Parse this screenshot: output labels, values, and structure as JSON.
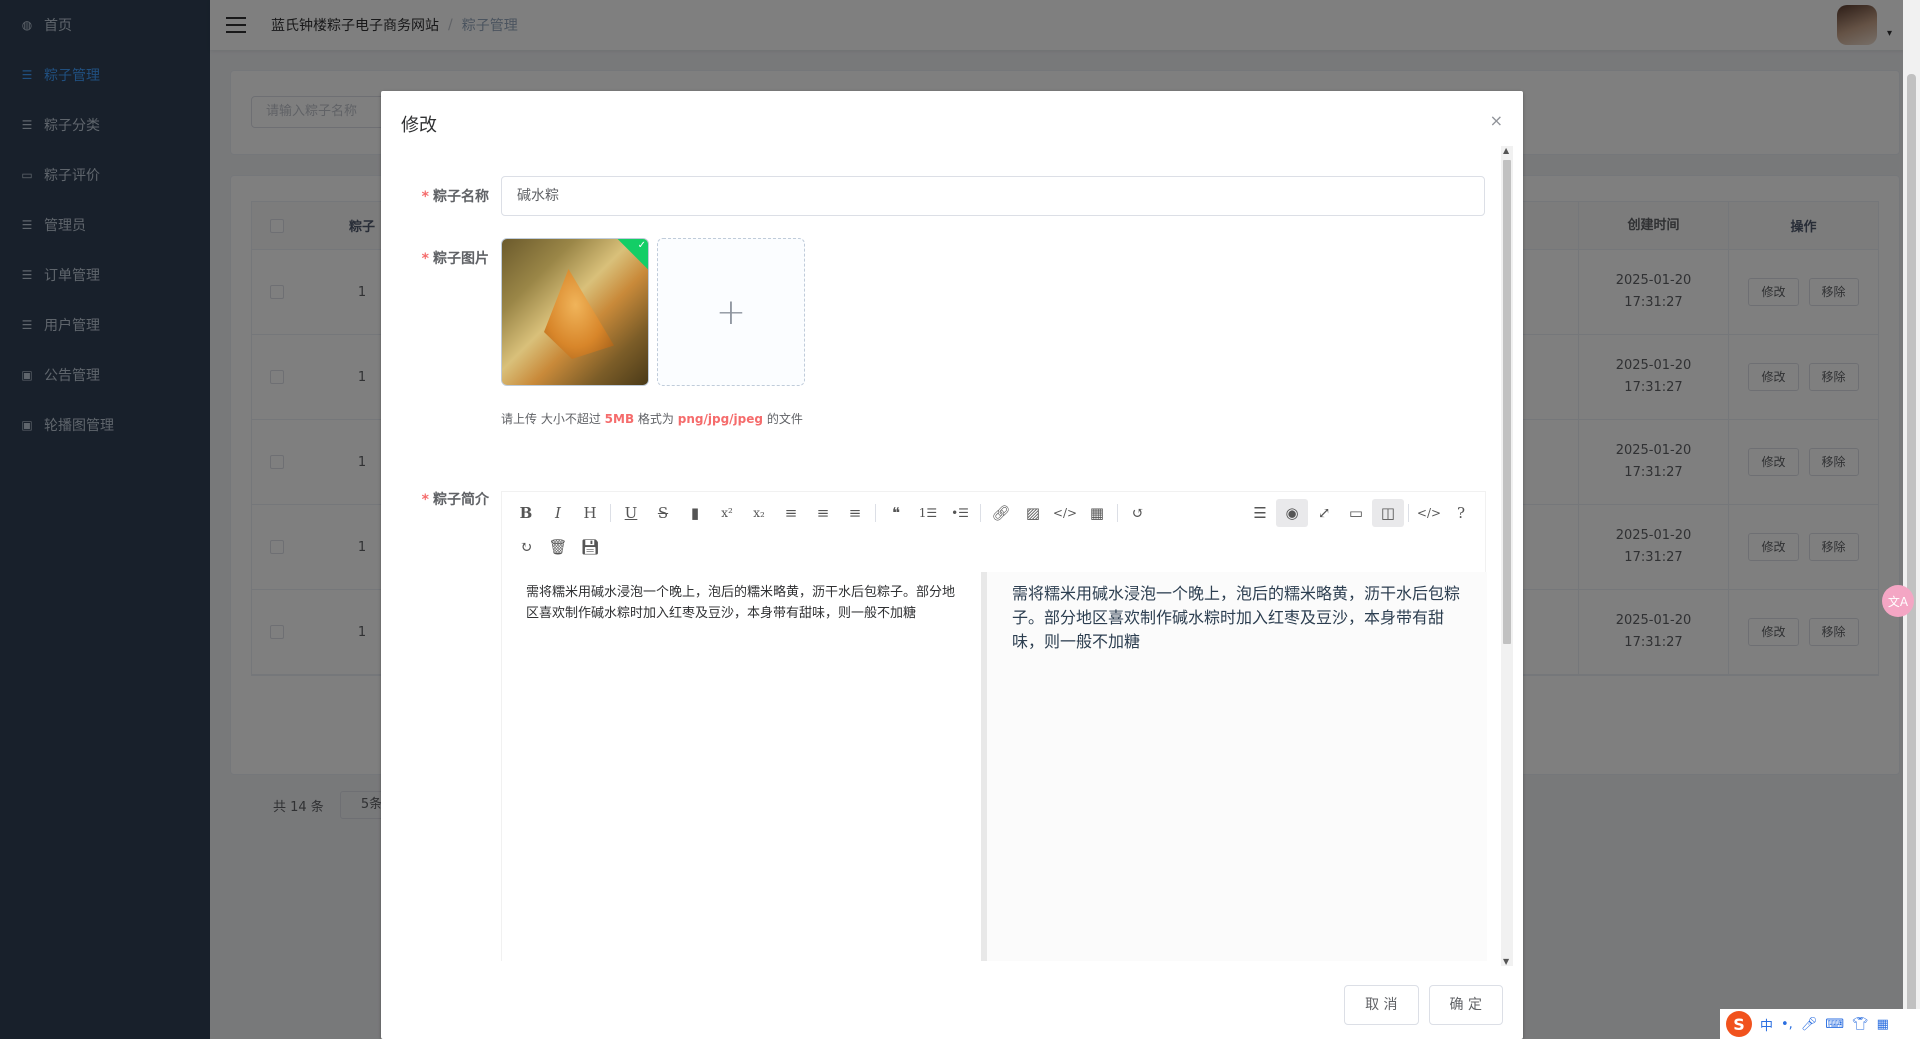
{
  "sidebar": {
    "items": [
      {
        "label": "首页",
        "icon": "dashboard-icon"
      },
      {
        "label": "粽子管理",
        "icon": "list-icon",
        "active": true
      },
      {
        "label": "粽子分类",
        "icon": "list-icon"
      },
      {
        "label": "粽子评价",
        "icon": "message-icon"
      },
      {
        "label": "管理员",
        "icon": "list-icon"
      },
      {
        "label": "订单管理",
        "icon": "list-icon"
      },
      {
        "label": "用户管理",
        "icon": "list-icon"
      },
      {
        "label": "公告管理",
        "icon": "briefcase-icon"
      },
      {
        "label": "轮播图管理",
        "icon": "briefcase-icon"
      }
    ]
  },
  "navbar": {
    "breadcrumb_home": "蓝氏钟楼粽子电子商务网站",
    "breadcrumb_sep": "/",
    "breadcrumb_current": "粽子管理"
  },
  "search": {
    "placeholder": "请输入粽子名称"
  },
  "table": {
    "headers": {
      "col2": "粽子",
      "created": "创建时间",
      "ops": "操作"
    },
    "rows": [
      {
        "id": "1",
        "created": "2025-01-20 17:31:27",
        "edit": "修改",
        "remove": "移除"
      },
      {
        "id": "1",
        "created": "2025-01-20 17:31:27",
        "edit": "修改",
        "remove": "移除"
      },
      {
        "id": "1",
        "created": "2025-01-20 17:31:27",
        "edit": "修改",
        "remove": "移除"
      },
      {
        "id": "1",
        "created": "2025-01-20 17:31:27",
        "edit": "修改",
        "remove": "移除"
      },
      {
        "id": "1",
        "created": "2025-01-20 17:31:27",
        "edit": "修改",
        "remove": "移除"
      }
    ]
  },
  "pagination": {
    "total": "共 14 条",
    "page_size": "5条/"
  },
  "dialog": {
    "title": "修改",
    "close": "×",
    "fields": {
      "name_label": "粽子名称",
      "name_value": "碱水粽",
      "image_label": "粽子图片",
      "intro_label": "粽子简介"
    },
    "upload_tip": {
      "prefix": "请上传 大小不超过",
      "size": "5MB",
      "middle": "格式为",
      "formats": "png/jpg/jpeg",
      "suffix": "的文件"
    },
    "intro_text": "需将糯米用碱水浸泡一个晚上，泡后的糯米略黄，沥干水后包粽子。部分地区喜欢制作碱水粽时加入红枣及豆沙，本身带有甜味，则一般不加糖",
    "cancel": "取 消",
    "confirm": "确 定"
  },
  "editor": {
    "toolbar_row1": [
      "bold",
      "italic",
      "header",
      "underline",
      "strikethrough",
      "mark",
      "superscript",
      "subscript",
      "align-left",
      "align-center",
      "align-right",
      "quote",
      "ordered-list",
      "unordered-list",
      "link",
      "image",
      "code",
      "table",
      "undo"
    ],
    "toolbar_right": [
      "navigation",
      "preview",
      "fullscreen",
      "read-mode",
      "subfield",
      "html-code",
      "help"
    ]
  },
  "ime": {
    "lang": "中"
  }
}
